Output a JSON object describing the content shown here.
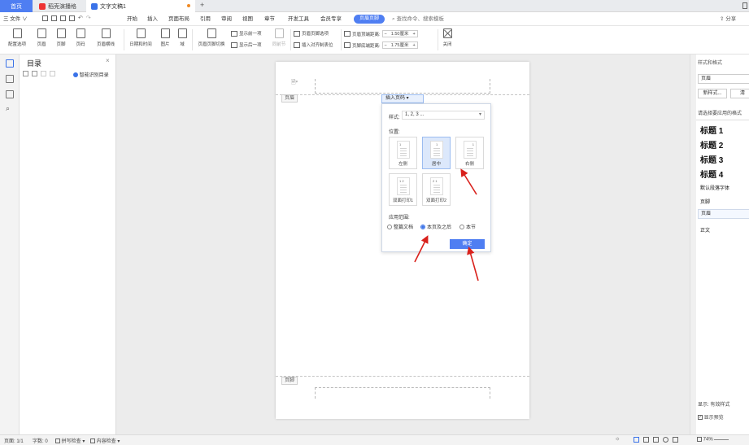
{
  "tabs": {
    "home": "首页",
    "pdf": "稻壳演播格",
    "doc": "文字文稿1",
    "new_tab": "+"
  },
  "menu": {
    "file": "三 文件 ∨",
    "items": [
      "开始",
      "插入",
      "页面布局",
      "引用",
      "审阅",
      "视图",
      "章节",
      "开发工具",
      "会员专享"
    ],
    "active": "页眉页脚",
    "search": "查找命令、搜索模板",
    "share": "分享"
  },
  "ribbon": {
    "options": "配置选项",
    "header": "页眉",
    "footer": "页脚",
    "page_num": "页码",
    "header_line": "页眉横线",
    "datetime": "日期和时间",
    "image": "图片",
    "field": "域",
    "switch": "页眉页脚切换",
    "show_prev": "显示前一项",
    "show_next": "显示后一项",
    "same_prev": "同前节",
    "odd_even": "页眉页脚选项",
    "align_tab": "插入对齐制表位",
    "header_top": "页眉顶端距离:",
    "header_top_val": "1.50厘米",
    "footer_bottom": "页脚底端距离:",
    "footer_bottom_val": "1.75厘米",
    "close": "关闭"
  },
  "toc": {
    "title": "目录",
    "smart": "智能识别目录",
    "close": "×"
  },
  "page": {
    "header_tag": "页眉",
    "footer_tag": "页脚"
  },
  "popup": {
    "insert_btn": "插入页码 ▾",
    "style_label": "样式:",
    "style_value": "1, 2, 3 ...",
    "position_label": "位置:",
    "positions": [
      "左侧",
      "居中",
      "右侧",
      "双面打印1",
      "双面打印2"
    ],
    "scope_label": "应用范围:",
    "scope": [
      "整篇文档",
      "本页及之后",
      "本节"
    ],
    "ok": "确定"
  },
  "right": {
    "title": "样式和格式",
    "current": "页眉",
    "new_style": "新样式...",
    "clear": "清",
    "hint": "请选择要应用的格式",
    "styles": [
      "标题 1",
      "标题 2",
      "标题 3",
      "标题 4"
    ],
    "default_font": "默认段落字体",
    "footer": "页脚",
    "header": "页眉",
    "body": "正文",
    "show_label": "显示:",
    "show_value": "有效样式",
    "preview": "显示预览"
  },
  "status": {
    "page": "页面: 1/1",
    "words": "字数: 0",
    "spell": "拼写检查 ▾",
    "content_check": "内容检查 ▾",
    "zoom": "74%"
  },
  "colors": {
    "accent": "#4f7ef2",
    "arrow": "#d9211c"
  }
}
